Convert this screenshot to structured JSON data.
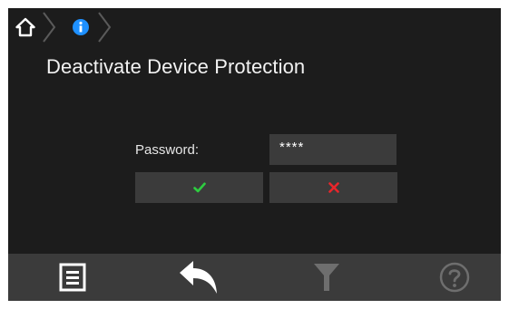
{
  "breadcrumb": {
    "items": [
      {
        "icon": "home-icon"
      },
      {
        "icon": "info-icon",
        "color": "#1e90ff"
      }
    ]
  },
  "page": {
    "title": "Deactivate Device Protection"
  },
  "form": {
    "password_label": "Password:",
    "password_value": "****",
    "confirm_icon": "check-icon",
    "confirm_color": "#2ecc40",
    "cancel_icon": "x-icon",
    "cancel_color": "#e8262b"
  },
  "toolbar": {
    "items": [
      {
        "icon": "list-icon",
        "enabled": true
      },
      {
        "icon": "back-arrow-icon",
        "enabled": true
      },
      {
        "icon": "filter-icon",
        "enabled": false
      },
      {
        "icon": "help-icon",
        "enabled": false
      }
    ]
  },
  "colors": {
    "background": "#1c1c1c",
    "panel": "#3b3b3b",
    "text": "#f2f2f2",
    "disabled_icon": "#6e6e6e"
  }
}
